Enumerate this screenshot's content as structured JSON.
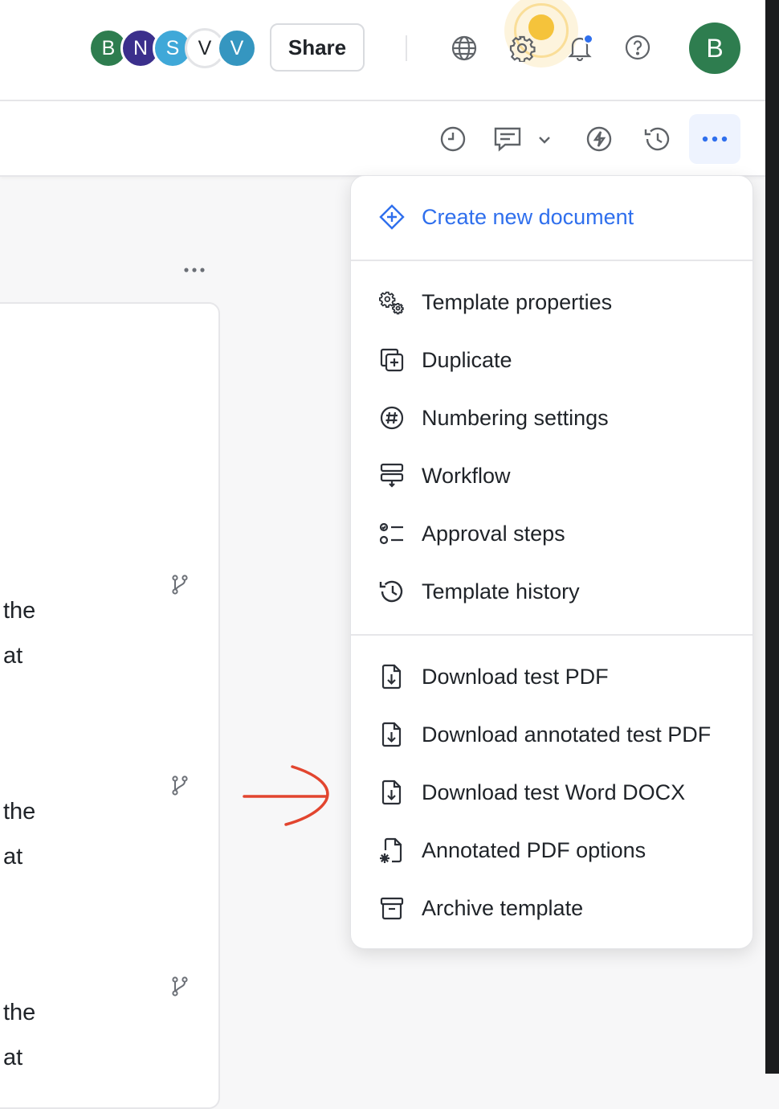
{
  "collaborators": [
    {
      "initial": "B",
      "color": "#2e7d4f"
    },
    {
      "initial": "N",
      "color": "#3b2f8c"
    },
    {
      "initial": "S",
      "color": "#3fa8d8"
    },
    {
      "initial": "V",
      "color": "#ffffff"
    },
    {
      "initial": "V",
      "color": "#3596c0"
    }
  ],
  "header": {
    "share_label": "Share",
    "user_initial": "B",
    "icons": [
      "globe-icon",
      "gear-icon",
      "bell-icon",
      "help-icon"
    ]
  },
  "toolbar": {
    "icons": [
      "clock-icon",
      "comment-icon",
      "chevron-down-icon",
      "lightning-icon",
      "history-icon",
      "more-icon"
    ]
  },
  "document": {
    "fragments": [
      "the",
      "at",
      "the",
      "at",
      "the",
      "at"
    ]
  },
  "menu": {
    "create_label": "Create new document",
    "items": [
      "Template properties",
      "Duplicate",
      "Numbering settings",
      "Workflow",
      "Approval steps",
      "Template history",
      "Download test PDF",
      "Download annotated test PDF",
      "Download test Word DOCX",
      "Annotated PDF options",
      "Archive template"
    ]
  },
  "colors": {
    "accent": "#2f6fed",
    "annotation_arrow": "#e2452f",
    "pulse": "#f5c33b"
  }
}
